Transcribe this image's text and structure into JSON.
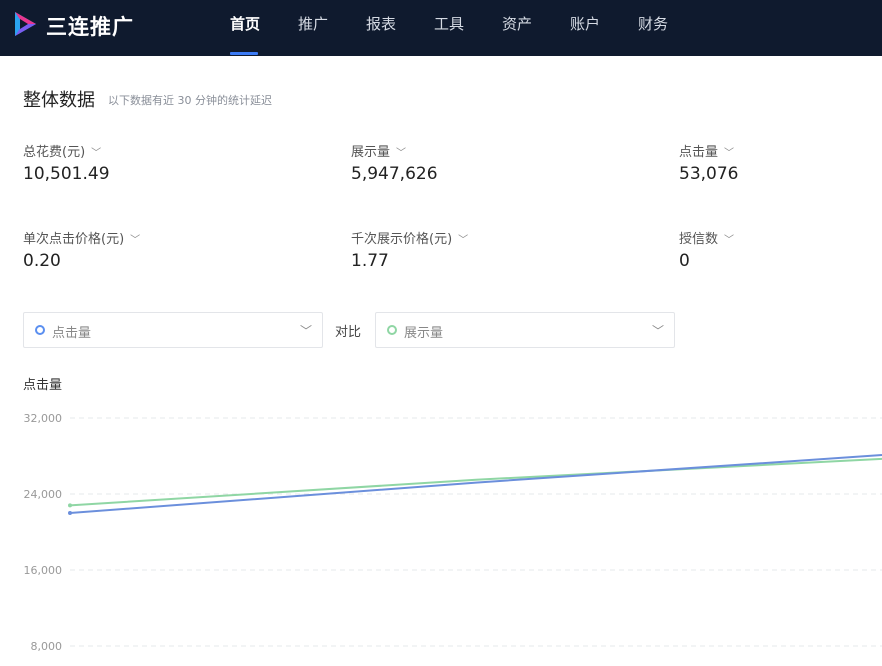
{
  "app": {
    "brand": "三连推广"
  },
  "nav": {
    "items": [
      {
        "label": "首页",
        "active": true
      },
      {
        "label": "推广",
        "active": false
      },
      {
        "label": "报表",
        "active": false
      },
      {
        "label": "工具",
        "active": false
      },
      {
        "label": "资产",
        "active": false
      },
      {
        "label": "账户",
        "active": false
      },
      {
        "label": "财务",
        "active": false
      }
    ]
  },
  "overview": {
    "title": "整体数据",
    "note": "以下数据有近 30 分钟的统计延迟"
  },
  "metrics": [
    {
      "label": "总花费(元)",
      "value": "10,501.49"
    },
    {
      "label": "展示量",
      "value": "5,947,626"
    },
    {
      "label": "点击量",
      "value": "53,076"
    },
    {
      "label": "单次点击价格(元)",
      "value": "0.20"
    },
    {
      "label": "千次展示价格(元)",
      "value": "1.77"
    },
    {
      "label": "授信数",
      "value": "0"
    }
  ],
  "compare": {
    "primary": {
      "value": "点击量",
      "color": "#5b8ff0"
    },
    "vs_label": "对比",
    "secondary": {
      "value": "展示量",
      "color": "#8fd6a4"
    }
  },
  "chart_data": {
    "type": "line",
    "title": "点击量",
    "ylim": [
      8000,
      32000
    ],
    "yticks": [
      "32,000",
      "24,000",
      "16,000",
      "8,000"
    ],
    "grid": true,
    "series": [
      {
        "name": "点击量",
        "color": "#6b8fdc",
        "values": [
          22000,
          25200,
          28100
        ]
      },
      {
        "name": "展示量",
        "color": "#8fd6a4",
        "values": [
          22800,
          25500,
          27700
        ]
      }
    ],
    "x": [
      0,
      0.5,
      1
    ]
  }
}
